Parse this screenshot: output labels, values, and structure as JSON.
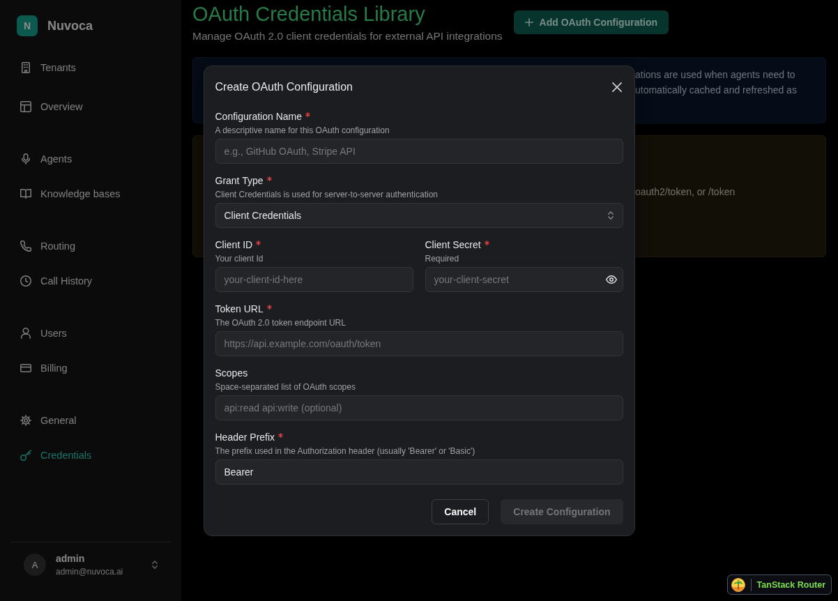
{
  "sidebar": {
    "brand": {
      "logo_letter": "N",
      "name": "Nuvoca"
    },
    "groups": [
      {
        "items": [
          {
            "label": "Tenants",
            "selected": false
          },
          {
            "label": "Overview",
            "selected": false
          }
        ]
      },
      {
        "items": [
          {
            "label": "Agents",
            "selected": false
          },
          {
            "label": "Knowledge bases",
            "selected": false
          }
        ]
      },
      {
        "items": [
          {
            "label": "Routing",
            "selected": false
          },
          {
            "label": "Call History",
            "selected": false
          }
        ]
      },
      {
        "items": [
          {
            "label": "Users",
            "selected": false
          },
          {
            "label": "Billing",
            "selected": false
          }
        ]
      },
      {
        "items": [
          {
            "label": "General",
            "selected": false
          },
          {
            "label": "Credentials",
            "selected": true
          }
        ]
      }
    ],
    "user": {
      "avatar_letter": "A",
      "name": "admin",
      "email": "admin@nuvoca.ai"
    }
  },
  "page": {
    "title": "OAuth Credentials Library",
    "subtitle": "Manage OAuth 2.0 client credentials for external API integrations",
    "add_button": "Add OAuth Configuration",
    "info_notice": {
      "lines": [
        "ations are used when agents need to",
        "utomatically cached and refreshed as"
      ]
    },
    "warning_notice": {
      "lines": [
        "oauth2/token, or /token"
      ]
    }
  },
  "dialog": {
    "title": "Create OAuth Configuration",
    "rows": [
      {
        "fields": [
          {
            "kind": "text",
            "label": "Configuration Name",
            "required": true,
            "description": "A descriptive name for this OAuth configuration",
            "placeholder": "e.g., GitHub OAuth, Stripe API"
          }
        ]
      },
      {
        "fields": [
          {
            "kind": "select",
            "label": "Grant Type",
            "required": true,
            "description": "Client Credentials is used for server-to-server authentication",
            "value": "Client Credentials"
          }
        ]
      },
      {
        "fields": [
          {
            "kind": "text",
            "label": "Client ID",
            "required": true,
            "description": "Your client Id",
            "placeholder": "your-client-id-here"
          },
          {
            "kind": "secret",
            "label": "Client Secret",
            "required": true,
            "description": "Required",
            "placeholder": "your-client-secret"
          }
        ]
      },
      {
        "fields": [
          {
            "kind": "text",
            "label": "Token URL",
            "required": true,
            "description": "The OAuth 2.0 token endpoint URL",
            "placeholder": "https://api.example.com/oauth/token"
          }
        ]
      },
      {
        "fields": [
          {
            "kind": "text",
            "label": "Scopes",
            "required": false,
            "description": "Space-separated list of OAuth scopes",
            "placeholder": "api:read api:write (optional)"
          }
        ]
      },
      {
        "fields": [
          {
            "kind": "text",
            "label": "Header Prefix",
            "required": true,
            "description": "The prefix used in the Authorization header (usually 'Bearer' or 'Basic')",
            "value": "Bearer"
          }
        ]
      }
    ],
    "buttons": [
      {
        "label": "Cancel",
        "kind": "secondary",
        "disabled": false
      },
      {
        "label": "Create Configuration",
        "kind": "primary",
        "disabled": true
      }
    ]
  },
  "devtools_badge": {
    "label": "TanStack Router"
  }
}
